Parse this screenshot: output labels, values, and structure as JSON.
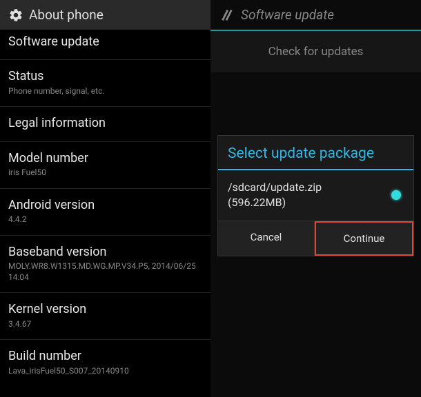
{
  "left": {
    "header": "About phone",
    "items": [
      {
        "title": "Software update",
        "sub": ""
      },
      {
        "title": "Status",
        "sub": "Phone number, signal, etc."
      },
      {
        "title": "Legal information",
        "sub": ""
      },
      {
        "title": "Model number",
        "sub": "iris Fuel50"
      },
      {
        "title": "Android version",
        "sub": "4.4.2"
      },
      {
        "title": "Baseband version",
        "sub": "MOLY.WR8.W1315.MD.WG.MP.V34.P5, 2014/06/25 14:04"
      },
      {
        "title": "Kernel version",
        "sub": "3.4.67"
      },
      {
        "title": "Build number",
        "sub": "Lava_irisFuel50_S007_20140910"
      }
    ]
  },
  "right": {
    "header": "Software update",
    "check_button": "Check for updates",
    "dialog": {
      "title": "Select update package",
      "file_path": "/sdcard/update.zip",
      "file_size": "(596.22MB)",
      "cancel": "Cancel",
      "continue": "Continue"
    }
  }
}
